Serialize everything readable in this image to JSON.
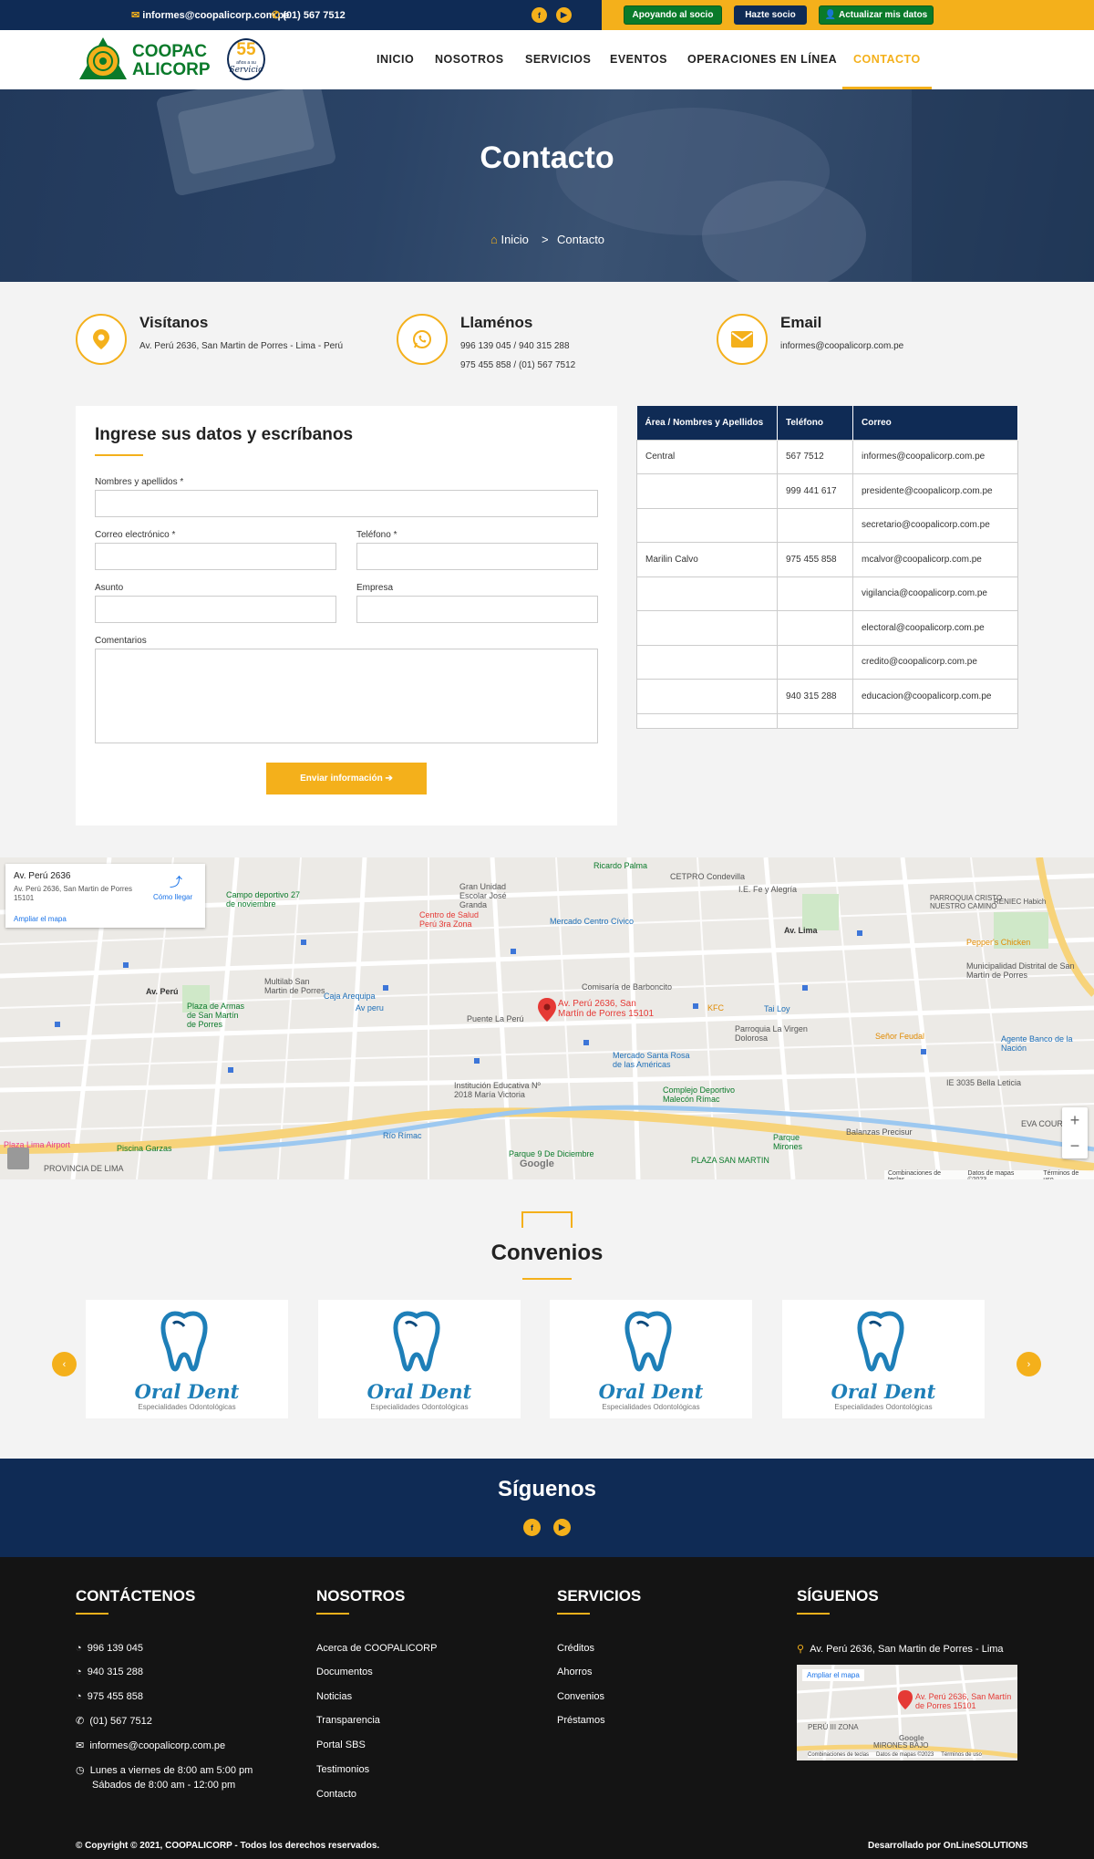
{
  "topbar": {
    "email": "informes@coopalicorp.com.pe",
    "phone": "(01) 567 7512",
    "social": [
      "f",
      "▶"
    ],
    "buttons": [
      "Apoyando al socio",
      "Hazte socio",
      "Actualizar mis datos"
    ]
  },
  "brand": {
    "line1": "COOPAC",
    "line2": "ALICORP",
    "years": "55",
    "years_sub": "años a su",
    "years_script": "Servicio"
  },
  "nav": [
    "INICIO",
    "NOSOTROS",
    "SERVICIOS",
    "EVENTOS",
    "OPERACIONES EN LÍNEA",
    "CONTACTO"
  ],
  "hero": {
    "title": "Contacto",
    "crumb_home": "Inicio",
    "crumb_sep": ">",
    "crumb_current": "Contacto"
  },
  "info": [
    {
      "title": "Visítanos",
      "lines": [
        "Av. Perú 2636, San Martin de Porres - Lima - Perú"
      ]
    },
    {
      "title": "Llaménos",
      "lines": [
        "996 139 045 / 940 315 288",
        "975 455 858 / (01) 567 7512"
      ]
    },
    {
      "title": "Email",
      "lines": [
        "informes@coopalicorp.com.pe"
      ]
    }
  ],
  "form": {
    "title": "Ingrese sus datos y escríbanos",
    "name": "Nombres y apellidos",
    "email": "Correo electrónico",
    "phone": "Teléfono",
    "subject": "Asunto",
    "company": "Empresa",
    "comments": "Comentarios",
    "required": "*",
    "submit": "Enviar información"
  },
  "table": {
    "headers": [
      "Área / Nombres y Apellidos",
      "Teléfono",
      "Correo"
    ],
    "rows": [
      [
        "Central",
        "567 7512",
        "informes@coopalicorp.com.pe"
      ],
      [
        "",
        "999 441 617",
        "presidente@coopalicorp.com.pe"
      ],
      [
        "",
        "",
        "secretario@coopalicorp.com.pe"
      ],
      [
        "Marilin Calvo",
        "975 455 858",
        "mcalvor@coopalicorp.com.pe"
      ],
      [
        "",
        "",
        "vigilancia@coopalicorp.com.pe"
      ],
      [
        "",
        "",
        "electoral@coopalicorp.com.pe"
      ],
      [
        "",
        "",
        "credito@coopalicorp.com.pe"
      ],
      [
        "",
        "940 315 288",
        "educacion@coopalicorp.com.pe"
      ],
      [
        "",
        "",
        ""
      ]
    ]
  },
  "map": {
    "place": "Av. Perú 2636",
    "address": "Av. Perú 2636, San Martin de Porres 15101",
    "directions": "Cómo llegar",
    "enlarge": "Ampliar el mapa",
    "pin": "Av. Perú 2636, San Martín de Porres 15101",
    "footer": [
      "Combinaciones de teclas",
      "Datos de mapas ©2023",
      "Términos de uso"
    ],
    "google": "Google",
    "zoom_in": "+",
    "zoom_out": "−",
    "labels": [
      "Ricardo Palma",
      "CETPRO Condevilla",
      "I.E. Fe y Alegría",
      "PARROQUIA CRISTO NUESTRO CAMINO",
      "RENIEC Habich",
      "Campo deportivo 27 de noviembre",
      "Gran Unidad Escolar José Granda",
      "Centro de Salud Perú 3ra Zona",
      "Mercado Centro Cívico",
      "Comisaría de Barboncito",
      "Multilab San Martin de Porres",
      "Caja Arequipa",
      "Av peru",
      "Plaza de Armas de San Martín de Porres",
      "Puente La Perú",
      "KFC",
      "Tai Loy",
      "Parroquia La Virgen Dolorosa",
      "Señor Feudal",
      "Mercado Santa Rosa de las Américas",
      "Institución Educativa Nº 2018 María Victoria",
      "Complejo Deportivo Malecón Rímac",
      "IE 3035 Bella Leticia",
      "Piscina Garzas",
      "Parque 9 De Diciembre",
      "PLAZA SAN MARTIN",
      "Parque Mirones",
      "Balanzas Precisur",
      "Municipalidad Distrital de San Martín de Porres",
      "Pepper's Chicken",
      "Agente Banco de la Nación",
      "EVA COURIER",
      "Av. Perú",
      "Av. Lima",
      "Río Rímac",
      "PROVINCIA DE LIMA",
      "Plaza Lima Airport"
    ]
  },
  "convenios": {
    "title": "Convenios",
    "brand": "Oral Dent",
    "brand_sub": "Especialidades Odontológicas",
    "prev": "‹",
    "next": "›"
  },
  "siguenos": {
    "title": "Síguenos",
    "social": [
      "f",
      "▶"
    ]
  },
  "footer": {
    "col1": {
      "title": "CONTÁCTENOS",
      "items": [
        "996 139 045",
        "940 315 288",
        "975 455 858",
        "(01) 567 7512",
        "informes@coopalicorp.com.pe"
      ],
      "hours1": "Lunes a viernes de 8:00 am 5:00 pm",
      "hours2": "Sábados de 8:00 am - 12:00 pm"
    },
    "col2": {
      "title": "NOSOTROS",
      "items": [
        "Acerca de COOPALICORP",
        "Documentos",
        "Noticias",
        "Transparencia",
        "Portal SBS",
        "Testimonios",
        "Contacto"
      ]
    },
    "col3": {
      "title": "SERVICIOS",
      "items": [
        "Créditos",
        "Ahorros",
        "Convenios",
        "Préstamos"
      ]
    },
    "col4": {
      "title": "SÍGUENOS",
      "address": "Av. Perú 2636, San Martin de Porres - Lima",
      "map_enlarge": "Ampliar el mapa",
      "map_pin": "Av. Perú 2636, San Martín de Porres 15101",
      "map_label": "PERÚ III ZONA",
      "map_label2": "MIRONES BAJO",
      "map_google": "Google",
      "map_footer": [
        "Combinaciones de teclas",
        "Datos de mapas ©2023",
        "Términos de uso"
      ]
    },
    "copyright": "Copyright © 2021, COOPALICORP - Todos los derechos reservados.",
    "dev": "Desarrollado por OnLineSOLUTIONS"
  },
  "colors": {
    "navy": "#0f2b55",
    "gold": "#f4b01b",
    "green": "#0a7a2a"
  }
}
